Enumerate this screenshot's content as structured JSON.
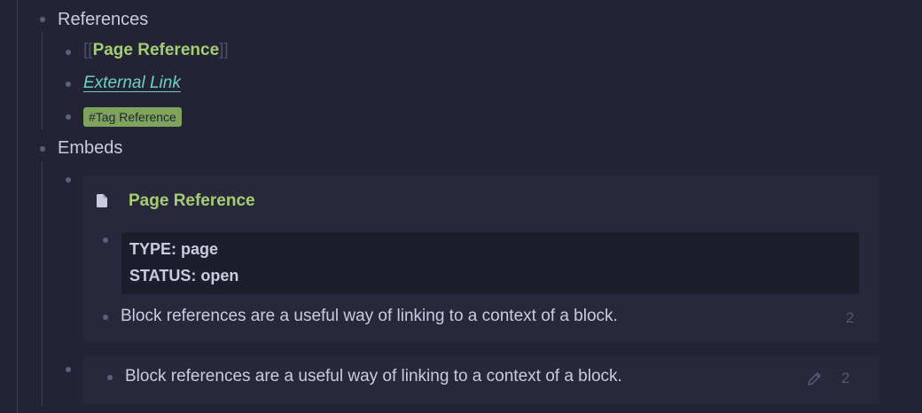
{
  "references": {
    "label": "References",
    "page_ref": {
      "open_bracket": "[[",
      "label": "Page Reference",
      "close_bracket": "]]"
    },
    "external_link": "External Link",
    "tag": "#Tag Reference"
  },
  "embeds": {
    "label": "Embeds",
    "page_embed": {
      "title": "Page Reference",
      "icon": "document-icon",
      "attributes": [
        "TYPE: page",
        "STATUS: open"
      ],
      "block_text": "Block references are a useful way of linking to a context of a block.",
      "block_ref_count": "2"
    },
    "block_embed": {
      "text": "Block references are a useful way of linking to a context of a block.",
      "ref_count": "2",
      "edit_icon": "pencil-icon"
    }
  },
  "colors": {
    "background": "#232335",
    "page_ref": "#a4ce72",
    "link": "#6bd0c6",
    "tag_bg": "#7ea45b"
  }
}
